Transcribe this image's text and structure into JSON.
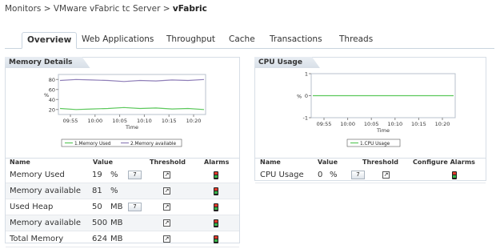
{
  "breadcrumb": {
    "path": "Monitors > VMware vFabric tc Server > ",
    "current": "vFabric"
  },
  "tabs": [
    {
      "label": "Overview",
      "active": true
    },
    {
      "label": "Web Applications"
    },
    {
      "label": "Throughput"
    },
    {
      "label": "Cache"
    },
    {
      "label": "Transactions"
    },
    {
      "label": "Threads"
    }
  ],
  "memory": {
    "title": "Memory Details",
    "table_headers": {
      "name": "Name",
      "value": "Value",
      "threshold": "Threshold",
      "alarms": "Alarms"
    },
    "rows": [
      {
        "name": "Memory Used",
        "value": "19",
        "unit": "%",
        "has_button": true,
        "button_label": "7"
      },
      {
        "name": "Memory available",
        "value": "81",
        "unit": "%",
        "has_button": false
      },
      {
        "name": "Used Heap",
        "value": "50",
        "unit": "MB",
        "has_button": true,
        "button_label": "7"
      },
      {
        "name": "Memory available",
        "value": "500",
        "unit": "MB",
        "has_button": false
      },
      {
        "name": "Total Memory",
        "value": "624",
        "unit": "MB",
        "has_button": false
      }
    ]
  },
  "cpu": {
    "title": "CPU Usage",
    "table_headers": {
      "name": "Name",
      "value": "Value",
      "threshold": "Threshold",
      "alarms": "Configure Alarms"
    },
    "rows": [
      {
        "name": "CPU Usage",
        "value": "0",
        "unit": "%",
        "has_button": true,
        "button_label": "7"
      }
    ]
  },
  "chart_data": [
    {
      "type": "line",
      "ylabel": "%",
      "xlabel": "Time",
      "x": [
        "09:55",
        "10:00",
        "10:05",
        "10:10",
        "10:15",
        "10:20"
      ],
      "yticks": [
        20,
        40,
        60,
        80
      ],
      "ylim": [
        10,
        90
      ],
      "series": [
        {
          "name": "1.Memory Used",
          "color": "#5cc85c",
          "values": [
            22,
            20,
            21,
            22,
            24,
            22,
            23,
            21,
            22,
            20
          ]
        },
        {
          "name": "2.Memory available",
          "color": "#8f7fb8",
          "values": [
            78,
            80,
            79,
            78,
            76,
            78,
            77,
            79,
            78,
            80
          ]
        }
      ]
    },
    {
      "type": "line",
      "ylabel": "%",
      "xlabel": "Time",
      "x": [
        "09:55",
        "10:00",
        "10:05",
        "10:10",
        "10:15",
        "10:20"
      ],
      "yticks": [
        -1,
        0,
        1
      ],
      "ylim": [
        -1,
        1
      ],
      "series": [
        {
          "name": "1.CPU Usage",
          "color": "#5cc85c",
          "values": [
            0,
            0,
            0,
            0,
            0,
            0,
            0,
            0,
            0,
            0
          ]
        }
      ]
    }
  ]
}
